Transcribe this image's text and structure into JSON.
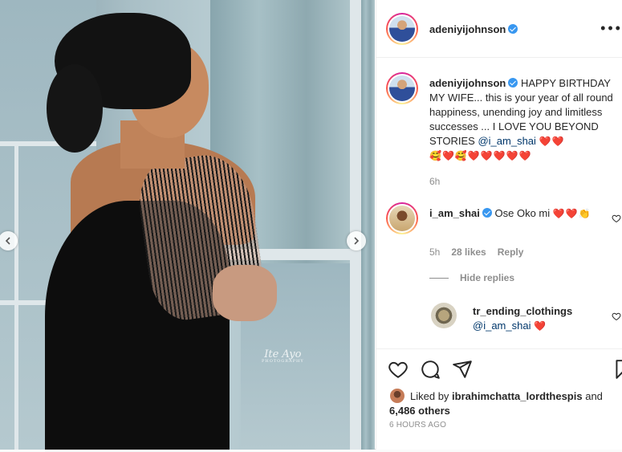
{
  "media": {
    "watermark_script": "Ite Ayo",
    "watermark_sub": "PHOTOGRAPHY"
  },
  "header": {
    "username": "adeniyijohnson",
    "more_icon": "more-horizontal-icon"
  },
  "caption": {
    "username": "adeniyijohnson",
    "text": "HAPPY BIRTHDAY MY WIFE... this is your year of all round happiness, unending joy and limitless successes ... I LOVE YOU BEYOND STORIES",
    "mention": "@i_am_shai",
    "emojis_inline": "❤️❤️",
    "emojis_line": "🥰❤️🥰❤️❤️❤️❤️❤️",
    "time": "6h"
  },
  "comments": [
    {
      "username": "i_am_shai",
      "text": "Ose Oko mi",
      "emojis": "❤️❤️👏",
      "emojis_wrap": "👏",
      "time": "5h",
      "likes": "28 likes",
      "reply": "Reply"
    }
  ],
  "hide_replies": "Hide replies",
  "reply": {
    "username": "tr_ending_clothings",
    "mention": "@i_am_shai",
    "emoji": "❤️"
  },
  "likes": {
    "prefix": "Liked by",
    "user": "ibrahimchatta_lordthespis",
    "and": "and",
    "others": "6,486 others"
  },
  "timestamp": "6 HOURS AGO",
  "colors": {
    "link": "#00376b",
    "verified": "#3897f0",
    "meta": "#8e8e8e"
  }
}
